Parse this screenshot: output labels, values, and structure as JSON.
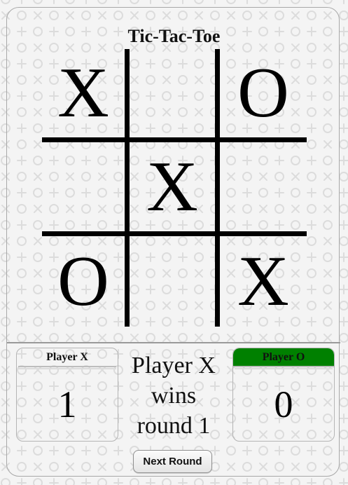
{
  "game": {
    "title": "Tic-Tac-Toe",
    "board": [
      [
        "X",
        "",
        "O"
      ],
      [
        "",
        "X",
        ""
      ],
      [
        "O",
        "",
        "X"
      ]
    ]
  },
  "scoreboard": {
    "player_x": {
      "label": "Player X",
      "score": "1"
    },
    "player_o": {
      "label": "Player O",
      "score": "0",
      "highlight_color": "#008000"
    }
  },
  "status": {
    "line1": "Player X",
    "line2": "wins",
    "line3": "round 1"
  },
  "controls": {
    "next_round_label": "Next Round"
  },
  "colors": {
    "background": "#f4f4f4",
    "pattern": "#dcdcdc",
    "grid": "#000000",
    "accent": "#008000"
  }
}
